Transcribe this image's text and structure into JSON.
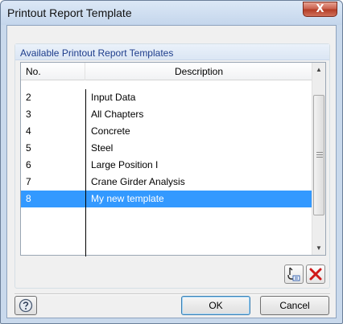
{
  "window": {
    "title": "Printout Report Template",
    "close_glyph": "X"
  },
  "group": {
    "title": "Available Printout Report Templates"
  },
  "table": {
    "headers": {
      "no": "No.",
      "description": "Description"
    },
    "rows": [
      {
        "no": "2",
        "description": "Input Data"
      },
      {
        "no": "3",
        "description": "All Chapters"
      },
      {
        "no": "4",
        "description": "Concrete"
      },
      {
        "no": "5",
        "description": "Steel"
      },
      {
        "no": "6",
        "description": "Large Position I"
      },
      {
        "no": "7",
        "description": "Crane Girder Analysis"
      },
      {
        "no": "8",
        "description": "My new template"
      }
    ],
    "selected_no": "8"
  },
  "toolbar": {
    "edit_icon": "edit-template-icon",
    "delete_icon": "delete-icon"
  },
  "buttons": {
    "help_icon": "help-icon",
    "ok": "OK",
    "cancel": "Cancel"
  },
  "colors": {
    "selection": "#3399ff",
    "group_title": "#1e3d8c",
    "delete_red": "#d01818"
  }
}
